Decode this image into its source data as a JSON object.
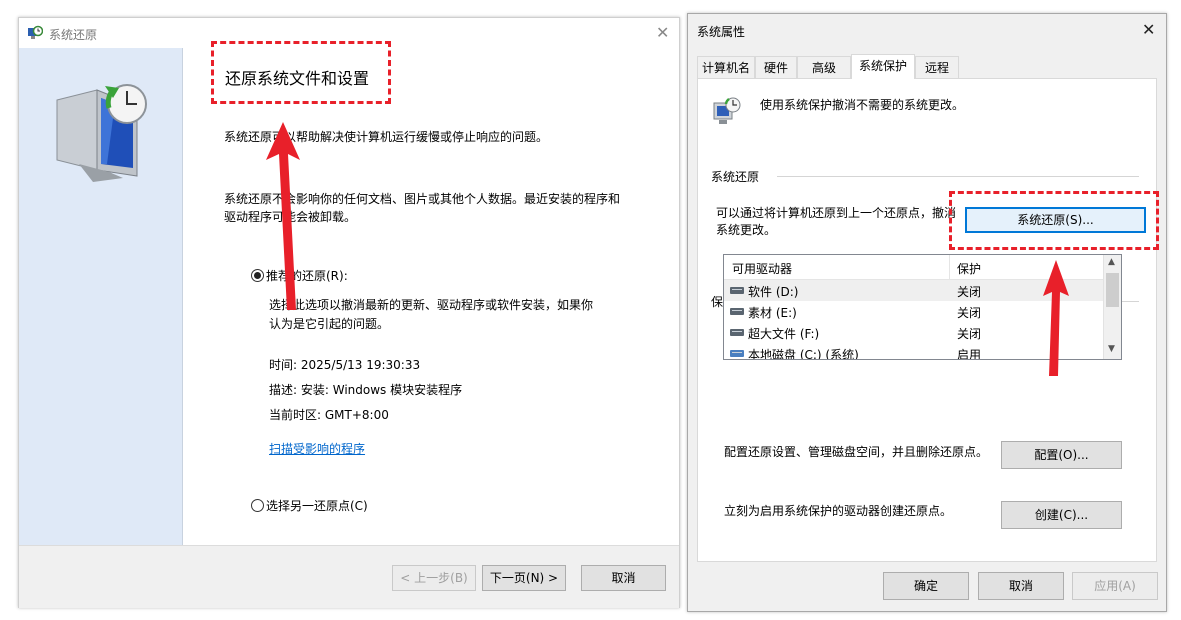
{
  "restore_window": {
    "title": "系统还原",
    "heading": "还原系统文件和设置",
    "intro": "系统还原可以帮助解决使计算机运行缓慢或停止响应的问题。",
    "note_line1": "系统还原不会影响你的任何文档、图片或其他个人数据。最近安装的程序和",
    "note_line2": "驱动程序可能会被卸载。",
    "option_recommended": "推荐的还原(R):",
    "recommended_desc_line1": "选择此选项以撤消最新的更新、驱动程序或软件安装，如果你",
    "recommended_desc_line2": "认为是它引起的问题。",
    "time": "时间: 2025/5/13 19:30:33",
    "description": "描述: 安装: Windows 模块安装程序",
    "timezone": "当前时区: GMT+8:00",
    "scan_link": "扫描受影响的程序",
    "option_other": "选择另一还原点(C)",
    "back_button": "< 上一步(B)",
    "next_button": "下一页(N) >",
    "cancel_button": "取消"
  },
  "properties_window": {
    "title": "系统属性",
    "tabs": [
      "计算机名",
      "硬件",
      "高级",
      "系统保护",
      "远程"
    ],
    "active_tab": "系统保护",
    "header_text": "使用系统保护撤消不需要的系统更改。",
    "restore_group_label": "系统还原",
    "restore_desc_line1": "可以通过将计算机还原到上一个还原点，撤消",
    "restore_desc_line2": "系统更改。",
    "restore_button": "系统还原(S)...",
    "protection_group_label": "保护设置",
    "list_columns": [
      "可用驱动器",
      "保护"
    ],
    "drives": [
      {
        "name": "软件 (D:)",
        "protection": "关闭"
      },
      {
        "name": "素材 (E:)",
        "protection": "关闭"
      },
      {
        "name": "超大文件 (F:)",
        "protection": "关闭"
      },
      {
        "name": "本地磁盘 (C:) (系统)",
        "protection": "启用"
      }
    ],
    "configure_text": "配置还原设置、管理磁盘空间，并且删除还原点。",
    "configure_button": "配置(O)...",
    "create_text": "立刻为启用系统保护的驱动器创建还原点。",
    "create_button": "创建(C)...",
    "ok_button": "确定",
    "cancel_button": "取消",
    "apply_button": "应用(A)"
  },
  "colors": {
    "annotation_red": "#e8202a",
    "focus_blue": "#0078d7",
    "sidebar_blue": "#dfe9f7",
    "link_blue": "#0066cc"
  }
}
